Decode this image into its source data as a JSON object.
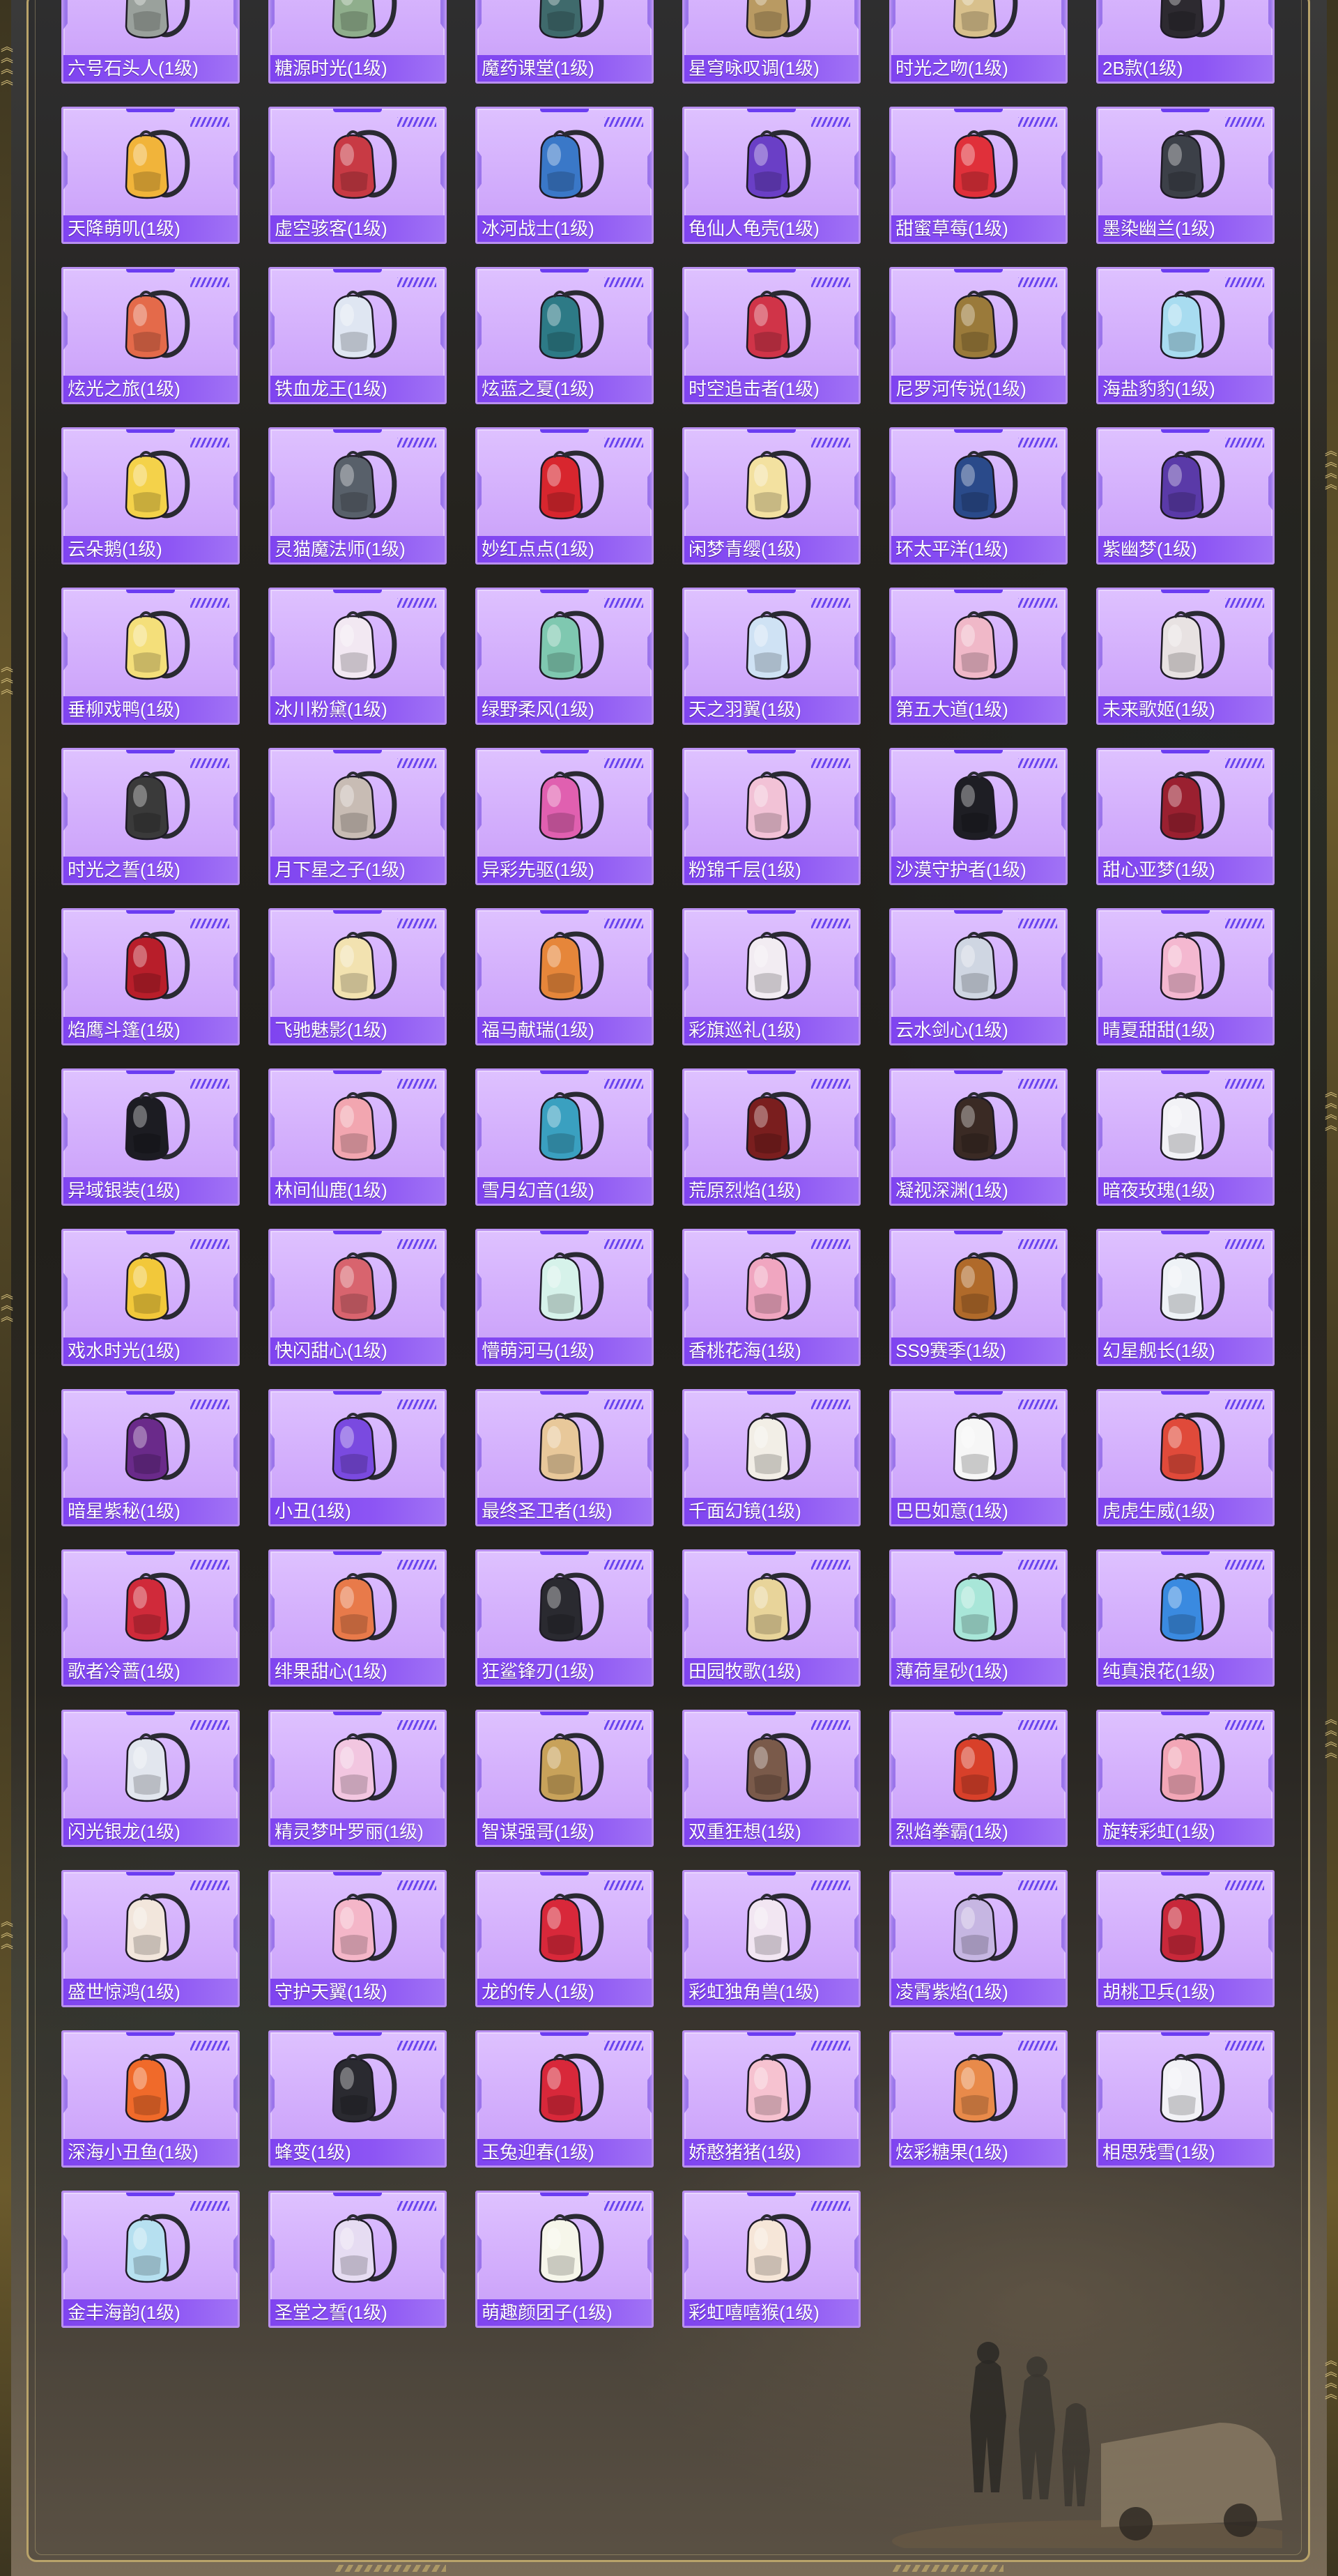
{
  "items": [
    {
      "label": "六号石头人(1级)",
      "icon": "robot-backpack-icon",
      "color": "#9aa19c"
    },
    {
      "label": "糖源时光(1级)",
      "icon": "bag-backpack-icon",
      "color": "#8fae8c"
    },
    {
      "label": "魔药课堂(1级)",
      "icon": "crest-backpack-icon",
      "color": "#3f6a6c"
    },
    {
      "label": "星穹咏叹调(1级)",
      "icon": "chest-backpack-icon",
      "color": "#b99a62"
    },
    {
      "label": "时光之吻(1级)",
      "icon": "clock-backpack-icon",
      "color": "#d8c08c"
    },
    {
      "label": "2B款(1级)",
      "icon": "dark-backpack-icon",
      "color": "#2d2a30"
    },
    {
      "label": "天降萌叽(1级)",
      "icon": "chick-backpack-icon",
      "color": "#f1b43a"
    },
    {
      "label": "虚空骇客(1级)",
      "icon": "mech-backpack-icon",
      "color": "#c83a44"
    },
    {
      "label": "冰河战士(1级)",
      "icon": "armor-backpack-icon",
      "color": "#3a78c8"
    },
    {
      "label": "龟仙人龟壳(1级)",
      "icon": "shell-backpack-icon",
      "color": "#6a3fc6"
    },
    {
      "label": "甜蜜草莓(1级)",
      "icon": "strawberry-backpack-icon",
      "color": "#e0303a"
    },
    {
      "label": "墨染幽兰(1级)",
      "icon": "orchid-backpack-icon",
      "color": "#3c4048"
    },
    {
      "label": "炫光之旅(1级)",
      "icon": "travel-backpack-icon",
      "color": "#e46a4a"
    },
    {
      "label": "铁血龙王(1级)",
      "icon": "dragon-backpack-icon",
      "color": "#dfe6f2"
    },
    {
      "label": "炫蓝之夏(1级)",
      "icon": "summer-backpack-icon",
      "color": "#2d7a86"
    },
    {
      "label": "时空追击者(1级)",
      "icon": "chaser-backpack-icon",
      "color": "#d03448"
    },
    {
      "label": "尼罗河传说(1级)",
      "icon": "nile-backpack-icon",
      "color": "#9a7a3a"
    },
    {
      "label": "海盐豹豹(1级)",
      "icon": "seal-backpack-icon",
      "color": "#a8dcf0"
    },
    {
      "label": "云朵鹅(1级)",
      "icon": "cloud-goose-icon",
      "color": "#f4d24a"
    },
    {
      "label": "灵猫魔法师(1级)",
      "icon": "cat-mage-icon",
      "color": "#58606a"
    },
    {
      "label": "妙红点点(1级)",
      "icon": "red-dot-icon",
      "color": "#d8262e"
    },
    {
      "label": "闲梦青缨(1级)",
      "icon": "tassel-backpack-icon",
      "color": "#f3e1a0"
    },
    {
      "label": "环太平洋(1级)",
      "icon": "pacific-backpack-icon",
      "color": "#2a4a8a"
    },
    {
      "label": "紫幽梦(1级)",
      "icon": "purple-dream-icon",
      "color": "#5a3aa8"
    },
    {
      "label": "垂柳戏鸭(1级)",
      "icon": "duck-backpack-icon",
      "color": "#f4df7a"
    },
    {
      "label": "冰川粉黛(1级)",
      "icon": "glacier-backpack-icon",
      "color": "#f2e8f2"
    },
    {
      "label": "绿野柔风(1级)",
      "icon": "green-wind-icon",
      "color": "#7fc8b0"
    },
    {
      "label": "天之羽翼(1级)",
      "icon": "wing-backpack-icon",
      "color": "#cfe2f4"
    },
    {
      "label": "第五大道(1级)",
      "icon": "avenue-backpack-icon",
      "color": "#f0b8c8"
    },
    {
      "label": "未来歌姬(1级)",
      "icon": "diva-backpack-icon",
      "color": "#e8e2e2"
    },
    {
      "label": "时光之誓(1级)",
      "icon": "spike-backpack-icon",
      "color": "#3a3a3a"
    },
    {
      "label": "月下星之子(1级)",
      "icon": "moon-star-icon",
      "color": "#c8bcb4"
    },
    {
      "label": "异彩先驱(1级)",
      "icon": "pioneer-backpack-icon",
      "color": "#e060b0"
    },
    {
      "label": "粉锦千层(1级)",
      "icon": "pink-layer-icon",
      "color": "#f2c2d6"
    },
    {
      "label": "沙漠守护者(1级)",
      "icon": "desert-guard-icon",
      "color": "#1e1e24"
    },
    {
      "label": "甜心亚梦(1级)",
      "icon": "sweetheart-backpack-icon",
      "color": "#9a2030"
    },
    {
      "label": "焰鹰斗篷(1级)",
      "icon": "flame-cloak-icon",
      "color": "#b81e2a"
    },
    {
      "label": "飞驰魅影(1级)",
      "icon": "phantom-backpack-icon",
      "color": "#f2e2b0"
    },
    {
      "label": "福马献瑞(1级)",
      "icon": "horse-backpack-icon",
      "color": "#e6863a"
    },
    {
      "label": "彩旗巡礼(1级)",
      "icon": "flag-backpack-icon",
      "color": "#f2ecf2"
    },
    {
      "label": "云水剑心(1级)",
      "icon": "sword-backpack-icon",
      "color": "#cfd6e2"
    },
    {
      "label": "晴夏甜甜(1级)",
      "icon": "sunny-backpack-icon",
      "color": "#f4b8d0"
    },
    {
      "label": "异域银装(1级)",
      "icon": "silver-backpack-icon",
      "color": "#1c1c22"
    },
    {
      "label": "林间仙鹿(1级)",
      "icon": "deer-backpack-icon",
      "color": "#f2a6b0"
    },
    {
      "label": "雪月幻音(1级)",
      "icon": "snow-moon-icon",
      "color": "#3aa0c0"
    },
    {
      "label": "荒原烈焰(1级)",
      "icon": "wasteland-flame-icon",
      "color": "#7a1e1e"
    },
    {
      "label": "凝视深渊(1级)",
      "icon": "abyss-backpack-icon",
      "color": "#3a2a24"
    },
    {
      "label": "暗夜玫瑰(1级)",
      "icon": "rose-backpack-icon",
      "color": "#f2f2f6"
    },
    {
      "label": "戏水时光(1级)",
      "icon": "water-duck-icon",
      "color": "#f2c83a"
    },
    {
      "label": "快闪甜心(1级)",
      "icon": "flash-sweet-icon",
      "color": "#d8646e"
    },
    {
      "label": "懵萌河马(1级)",
      "icon": "hippo-backpack-icon",
      "color": "#d6f2ea"
    },
    {
      "label": "香桃花海(1级)",
      "icon": "peach-sea-icon",
      "color": "#f0a6c0"
    },
    {
      "label": "SS9赛季(1级)",
      "icon": "season-backpack-icon",
      "color": "#b06a2a"
    },
    {
      "label": "幻星舰长(1级)",
      "icon": "captain-backpack-icon",
      "color": "#eef2f6"
    },
    {
      "label": "暗星紫秘(1级)",
      "icon": "dark-star-icon",
      "color": "#6a2a8a"
    },
    {
      "label": "小丑(1级)",
      "icon": "clown-backpack-icon",
      "color": "#7a4ae0"
    },
    {
      "label": "最终圣卫者(1级)",
      "icon": "guardian-backpack-icon",
      "color": "#e8c89a"
    },
    {
      "label": "千面幻镜(1级)",
      "icon": "mirror-backpack-icon",
      "color": "#f2eee6"
    },
    {
      "label": "巴巴如意(1级)",
      "icon": "ruyi-backpack-icon",
      "color": "#f6f6f6"
    },
    {
      "label": "虎虎生威(1级)",
      "icon": "tiger-backpack-icon",
      "color": "#e04a3a"
    },
    {
      "label": "歌者冷蔷(1级)",
      "icon": "singer-backpack-icon",
      "color": "#d02a3a"
    },
    {
      "label": "绯果甜心(1级)",
      "icon": "fruit-sweet-icon",
      "color": "#e87a4a"
    },
    {
      "label": "狂鲨锋刃(1级)",
      "icon": "shark-backpack-icon",
      "color": "#2a2a30"
    },
    {
      "label": "田园牧歌(1级)",
      "icon": "basket-backpack-icon",
      "color": "#e8d49a"
    },
    {
      "label": "薄荷星砂(1级)",
      "icon": "mint-backpack-icon",
      "color": "#a8e6d8"
    },
    {
      "label": "纯真浪花(1级)",
      "icon": "wave-backpack-icon",
      "color": "#3a8ae0"
    },
    {
      "label": "闪光银龙(1级)",
      "icon": "silver-dragon-icon",
      "color": "#e2e6ee"
    },
    {
      "label": "精灵梦叶罗丽(1级)",
      "icon": "fairy-backpack-icon",
      "color": "#f2c6e0"
    },
    {
      "label": "智谋强哥(1级)",
      "icon": "smart-backpack-icon",
      "color": "#c8a25a"
    },
    {
      "label": "双重狂想(1级)",
      "icon": "double-fantasy-icon",
      "color": "#7a5a4a"
    },
    {
      "label": "烈焰拳霸(1级)",
      "icon": "fist-backpack-icon",
      "color": "#d8402a"
    },
    {
      "label": "旋转彩虹(1级)",
      "icon": "rainbow-spin-icon",
      "color": "#f2a6b6"
    },
    {
      "label": "盛世惊鸿(1级)",
      "icon": "prosper-backpack-icon",
      "color": "#f2e6dc"
    },
    {
      "label": "守护天翼(1级)",
      "icon": "guard-wing-icon",
      "color": "#f4b6c8"
    },
    {
      "label": "龙的传人(1级)",
      "icon": "dragon-heir-icon",
      "color": "#d8283a"
    },
    {
      "label": "彩虹独角兽(1级)",
      "icon": "unicorn-backpack-icon",
      "color": "#f2e6f2"
    },
    {
      "label": "凌霄紫焰(1级)",
      "icon": "violet-flame-icon",
      "color": "#c6b6e2"
    },
    {
      "label": "胡桃卫兵(1级)",
      "icon": "nutcracker-backpack-icon",
      "color": "#c8283a"
    },
    {
      "label": "深海小丑鱼(1级)",
      "icon": "clownfish-backpack-icon",
      "color": "#f06a2a"
    },
    {
      "label": "蜂变(1级)",
      "icon": "bee-backpack-icon",
      "color": "#2a2a30"
    },
    {
      "label": "玉兔迎春(1级)",
      "icon": "jade-rabbit-icon",
      "color": "#d8283a"
    },
    {
      "label": "娇憨猪猪(1级)",
      "icon": "pig-backpack-icon",
      "color": "#f6c2d0"
    },
    {
      "label": "炫彩糖果(1级)",
      "icon": "donut-backpack-icon",
      "color": "#e88a4a"
    },
    {
      "label": "相思残雪(1级)",
      "icon": "snow-bunny-icon",
      "color": "#f2f2f6"
    },
    {
      "label": "金丰海韵(1级)",
      "icon": "sea-charm-icon",
      "color": "#b6e0f0"
    },
    {
      "label": "圣堂之誓(1级)",
      "icon": "sanctum-backpack-icon",
      "color": "#e6dcf2"
    },
    {
      "label": "萌趣颜团子(1级)",
      "icon": "dumpling-backpack-icon",
      "color": "#f6f6ea"
    },
    {
      "label": "彩虹嘻嘻猴(1级)",
      "icon": "monkey-backpack-icon",
      "color": "#f6e6d8"
    }
  ]
}
